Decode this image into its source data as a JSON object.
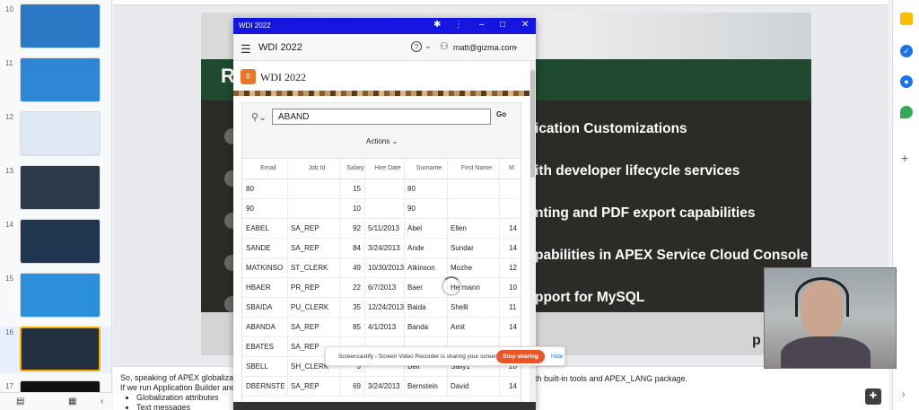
{
  "thumbnails": [
    {
      "number": "10",
      "color": "#2b78c5"
    },
    {
      "number": "11",
      "color": "#2f86d6"
    },
    {
      "number": "12",
      "color": "#dfe9f4"
    },
    {
      "number": "13",
      "color": "#2d3a4a"
    },
    {
      "number": "14",
      "color": "#1f3550"
    },
    {
      "number": "15",
      "color": "#2b8fd9"
    },
    {
      "number": "16",
      "color": "#22303f",
      "selected": true
    },
    {
      "number": "17",
      "color": "#111111"
    }
  ],
  "slide": {
    "heading_letter": "R",
    "bullets": [
      "ication Customizations",
      "ith developer lifecycle services",
      "nting and PDF export capabilities",
      "pabilities in APEX Service Cloud Console",
      "pport for MySQL"
    ],
    "brand_fragment": "p"
  },
  "notes": {
    "line1": "So, speaking of APEX globalizatio",
    "line1_right": "th built-in tools and APEX_LANG package.",
    "line2": "If we run Application Builder and",
    "bullets": [
      "Globalization attributes",
      "Text messages"
    ]
  },
  "app": {
    "window_title": "WDI 2022",
    "header_title": "WDI 2022",
    "user": "matt@gizma.com",
    "help_glyph": "?",
    "logo_letter": "8",
    "region_title": "WDI 2022",
    "search_value": "ABAND",
    "go_label": "Go",
    "actions_label": "Actions",
    "columns": [
      "Email",
      "Job Id",
      "Salary",
      "Hire Date",
      "Surname",
      "First Name",
      "M"
    ],
    "rows": [
      [
        "80",
        "",
        "15",
        "",
        "80",
        "",
        ""
      ],
      [
        "90",
        "",
        "10",
        "",
        "90",
        "",
        ""
      ],
      [
        "EABEL",
        "SA_REP",
        "92",
        "5/11/2013",
        "Abel",
        "Ellen",
        "14"
      ],
      [
        "SANDE",
        "SA_REP",
        "84",
        "3/24/2013",
        "Ande",
        "Sundar",
        "14"
      ],
      [
        "MATKINSO",
        "ST_CLERK",
        "49",
        "10/30/2013",
        "Atkinson",
        "Mozhe",
        "12"
      ],
      [
        "HBAER",
        "PR_REP",
        "22",
        "6/7/2013",
        "Baer",
        "Hermann",
        "10"
      ],
      [
        "SBAIDA",
        "PU_CLERK",
        "35",
        "12/24/2013",
        "Baida",
        "Shelli",
        "11"
      ],
      [
        "ABANDA",
        "SA_REP",
        "85",
        "4/1/2013",
        "Banda",
        "Amit",
        "14"
      ],
      [
        "EBATES",
        "SA_REP",
        "",
        "",
        "",
        "",
        ""
      ],
      [
        "SBELL",
        "SH_CLERK",
        "3",
        "",
        "Bell",
        "Sally1",
        "20"
      ],
      [
        "DBERNSTE",
        "SA_REP",
        "69",
        "3/24/2013",
        "Bernstein",
        "David",
        "14"
      ]
    ]
  },
  "screencastify": {
    "message": "Screencastify - Screen Video Recorder is sharing your screen.",
    "stop_label": "Stop sharing",
    "hide_label": "Hide"
  }
}
